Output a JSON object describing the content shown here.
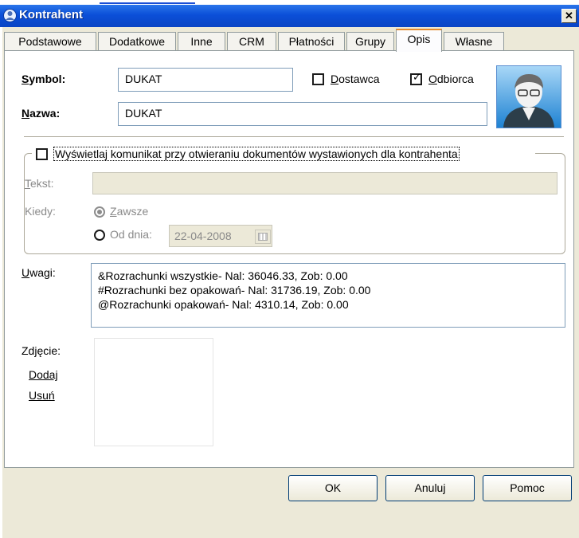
{
  "window": {
    "title": "Kontrahent",
    "close_glyph": "✕"
  },
  "tabs": [
    {
      "label": "Podstawowe",
      "active": false
    },
    {
      "label": "Dodatkowe",
      "active": false
    },
    {
      "label": "Inne",
      "active": false
    },
    {
      "label": "CRM",
      "active": false
    },
    {
      "label": "Płatności",
      "active": false
    },
    {
      "label": "Grupy",
      "active": false
    },
    {
      "label": "Opis",
      "active": true
    },
    {
      "label": "Własne",
      "active": false
    }
  ],
  "form": {
    "symbol_label": "Symbol:",
    "symbol_value": "DUKAT",
    "nazwa_label": "Nazwa:",
    "nazwa_value": "DUKAT",
    "dostawca_label": "Dostawca",
    "dostawca_checked": false,
    "odbiorca_label": "Odbiorca",
    "odbiorca_checked": true
  },
  "message_group": {
    "checkbox_label": "Wyświetlaj komunikat przy otwieraniu dokumentów wystawionych dla kontrahenta",
    "checked": false,
    "tekst_label": "Tekst:",
    "tekst_value": "",
    "kiedy_label": "Kiedy:",
    "zawsze_label": "Zawsze",
    "od_dnia_label": "Od dnia:",
    "date_value": "22-04-2008"
  },
  "uwagi": {
    "label": "Uwagi:",
    "lines": [
      "&Rozrachunki wszystkie- Nal: 36046.33, Zob: 0.00",
      "#Rozrachunki bez opakowań- Nal: 31736.19, Zob: 0.00",
      "@Rozrachunki opakowań- Nal: 4310.14, Zob: 0.00"
    ]
  },
  "photo": {
    "label": "Zdjęcie:",
    "add_link": "Dodaj",
    "remove_link": "Usuń"
  },
  "buttons": {
    "ok": "OK",
    "cancel": "Anuluj",
    "help": "Pomoc"
  },
  "colors": {
    "titlebar": "#0b4fd8",
    "tab_active_accent": "#e68b2c",
    "dialog_bg": "#ece9d8"
  }
}
